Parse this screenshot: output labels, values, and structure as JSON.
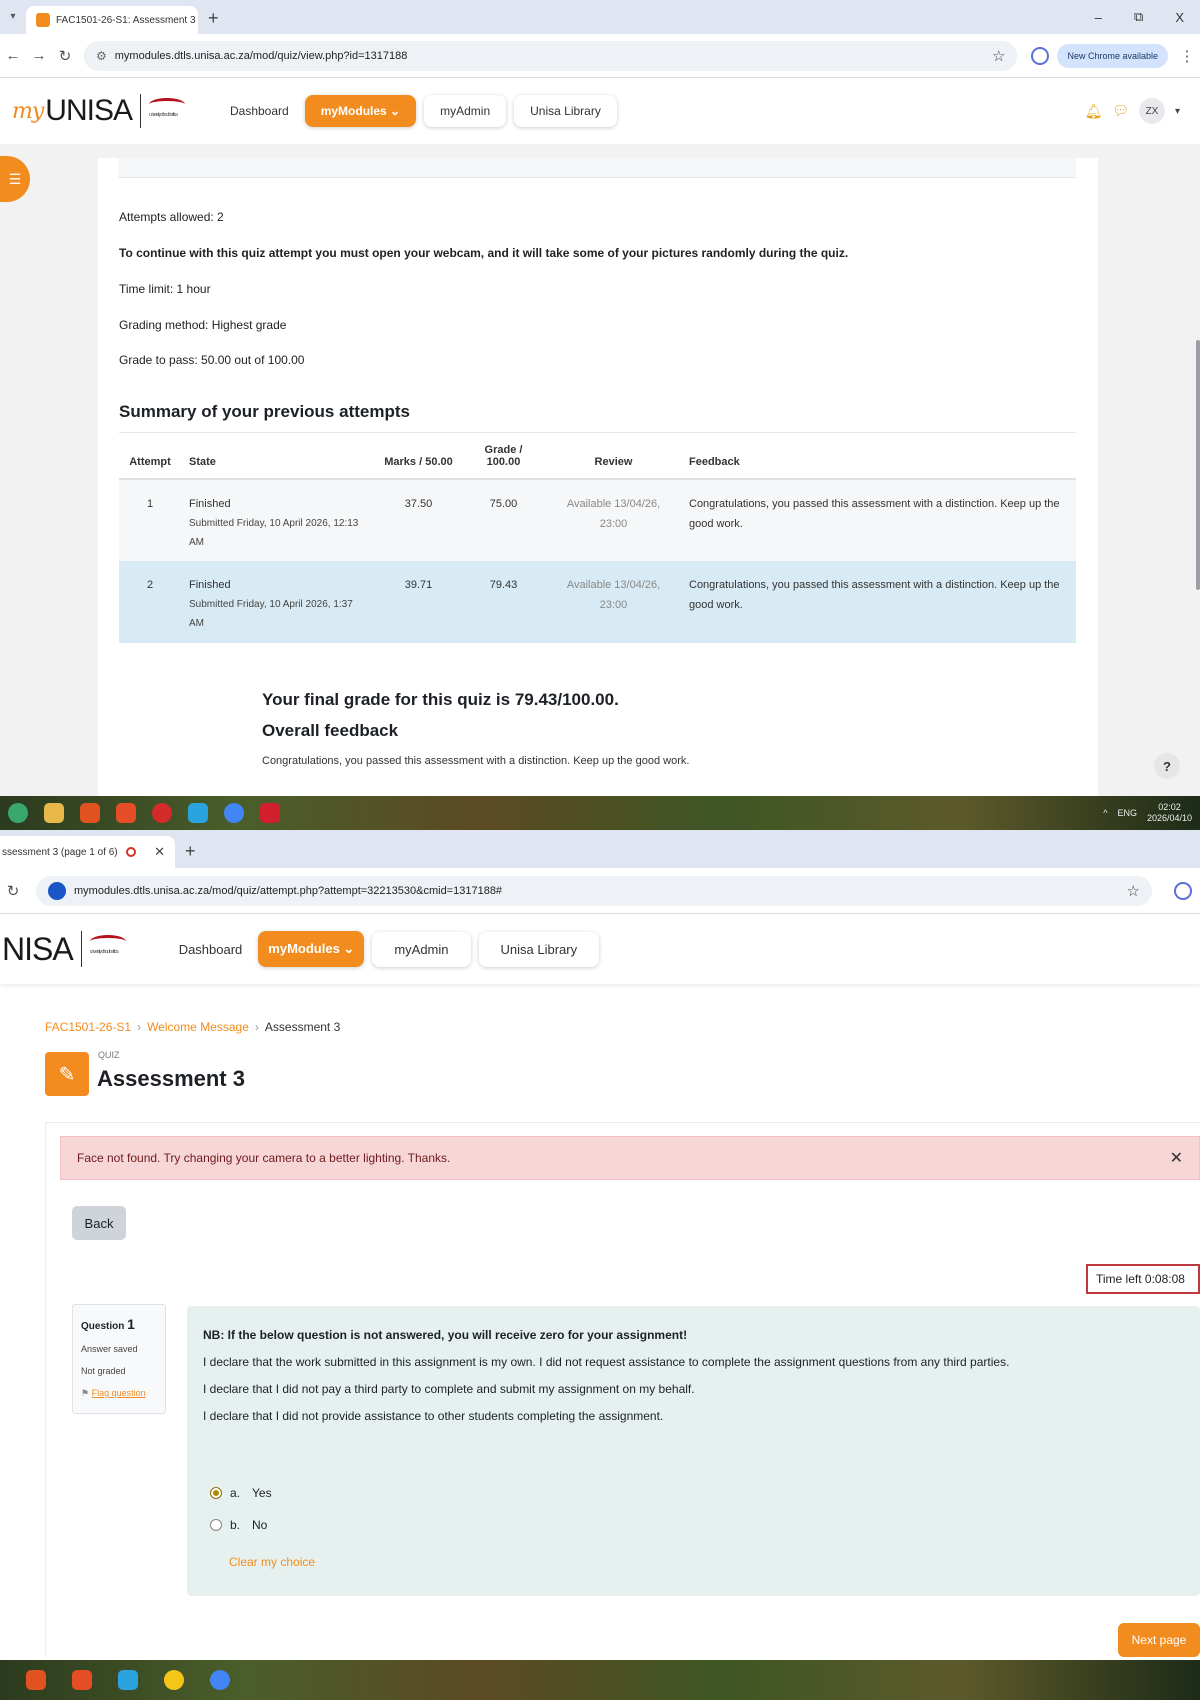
{
  "top_browser": {
    "tab_title": "FAC1501-26-S1: Assessment 3",
    "url": "mymodules.dtls.unisa.ac.za/mod/quiz/view.php?id=1317188",
    "chrome_badge": "New Chrome available",
    "window_min": "–",
    "window_restore": "⧉",
    "window_close": "X"
  },
  "site_header": {
    "logo_my": "my",
    "logo_text": "UNISA",
    "logo_text_cropped": "NISA",
    "nav": {
      "dashboard": "Dashboard",
      "mymodules": "myModules ⌄",
      "myadmin": "myAdmin",
      "library": "Unisa Library"
    },
    "avatar_initials": "ZX"
  },
  "quiz_info": {
    "attempts_allowed": "Attempts allowed: 2",
    "webcam_notice": "To continue with this quiz attempt you must open your webcam, and it will take some of your pictures randomly during the quiz.",
    "time_limit": "Time limit: 1 hour",
    "grading_method": "Grading method: Highest grade",
    "grade_to_pass": "Grade to pass: 50.00 out of 100.00"
  },
  "summary": {
    "heading": "Summary of your previous attempts",
    "columns": {
      "attempt": "Attempt",
      "state": "State",
      "marks": "Marks / 50.00",
      "grade": "Grade / 100.00",
      "review": "Review",
      "feedback": "Feedback"
    },
    "rows": [
      {
        "attempt": "1",
        "state": "Finished",
        "submitted": "Submitted Friday, 10 April 2026, 12:13 AM",
        "marks": "37.50",
        "grade": "75.00",
        "review": "Available 13/04/26, 23:00",
        "feedback": "Congratulations, you passed this assessment with a distinction. Keep up the good work."
      },
      {
        "attempt": "2",
        "state": "Finished",
        "submitted": "Submitted Friday, 10 April 2026, 1:37 AM",
        "marks": "39.71",
        "grade": "79.43",
        "review": "Available 13/04/26, 23:00",
        "feedback": "Congratulations, you passed this assessment with a distinction. Keep up the good work."
      }
    ],
    "final_grade": "Your final grade for this quiz is 79.43/100.00.",
    "overall_feedback_heading": "Overall feedback",
    "overall_feedback_text": "Congratulations, you passed this assessment with a distinction. Keep up the good work."
  },
  "help_label": "?",
  "taskbar_top": {
    "lang": "ENG",
    "time": "02:02",
    "date": "2026/04/10"
  },
  "bottom_browser": {
    "tab_title": "ssessment 3 (page 1 of 6)",
    "url": "mymodules.dtls.unisa.ac.za/mod/quiz/attempt.php?attempt=32213530&cmid=1317188#"
  },
  "quiz_page": {
    "breadcrumb": [
      "FAC1501-26-S1",
      "Welcome Message",
      "Assessment 3"
    ],
    "quiz_label": "QUIZ",
    "title": "Assessment 3",
    "alert": "Face not found. Try changing your camera to a better lighting. Thanks.",
    "back_button": "Back",
    "timer": "Time left 0:08:08",
    "question_info": {
      "question_label": "Question",
      "question_number": "1",
      "status": "Answer saved",
      "grading": "Not graded",
      "flag": "Flag question"
    },
    "question": {
      "nb": "NB: If the below question is not answered, you will receive zero for your assignment!",
      "line1": "I declare that the work submitted in this assignment is my own. I did not request assistance to complete the assignment questions from any third parties.",
      "line2": "I declare that I did not pay a third party to complete and submit my assignment on my behalf.",
      "line3": "I declare that I did not provide assistance to other students completing the assignment.",
      "options": [
        {
          "letter": "a.",
          "label": "Yes",
          "selected": true
        },
        {
          "letter": "b.",
          "label": "No",
          "selected": false
        }
      ],
      "clear_choice": "Clear my choice"
    },
    "next_button": "Next page"
  },
  "colors": {
    "accent": "#f28c1f",
    "alert_bg": "#f6d6d7",
    "question_bg": "#e6f1ef",
    "highlight_row": "#d8ebf4"
  }
}
